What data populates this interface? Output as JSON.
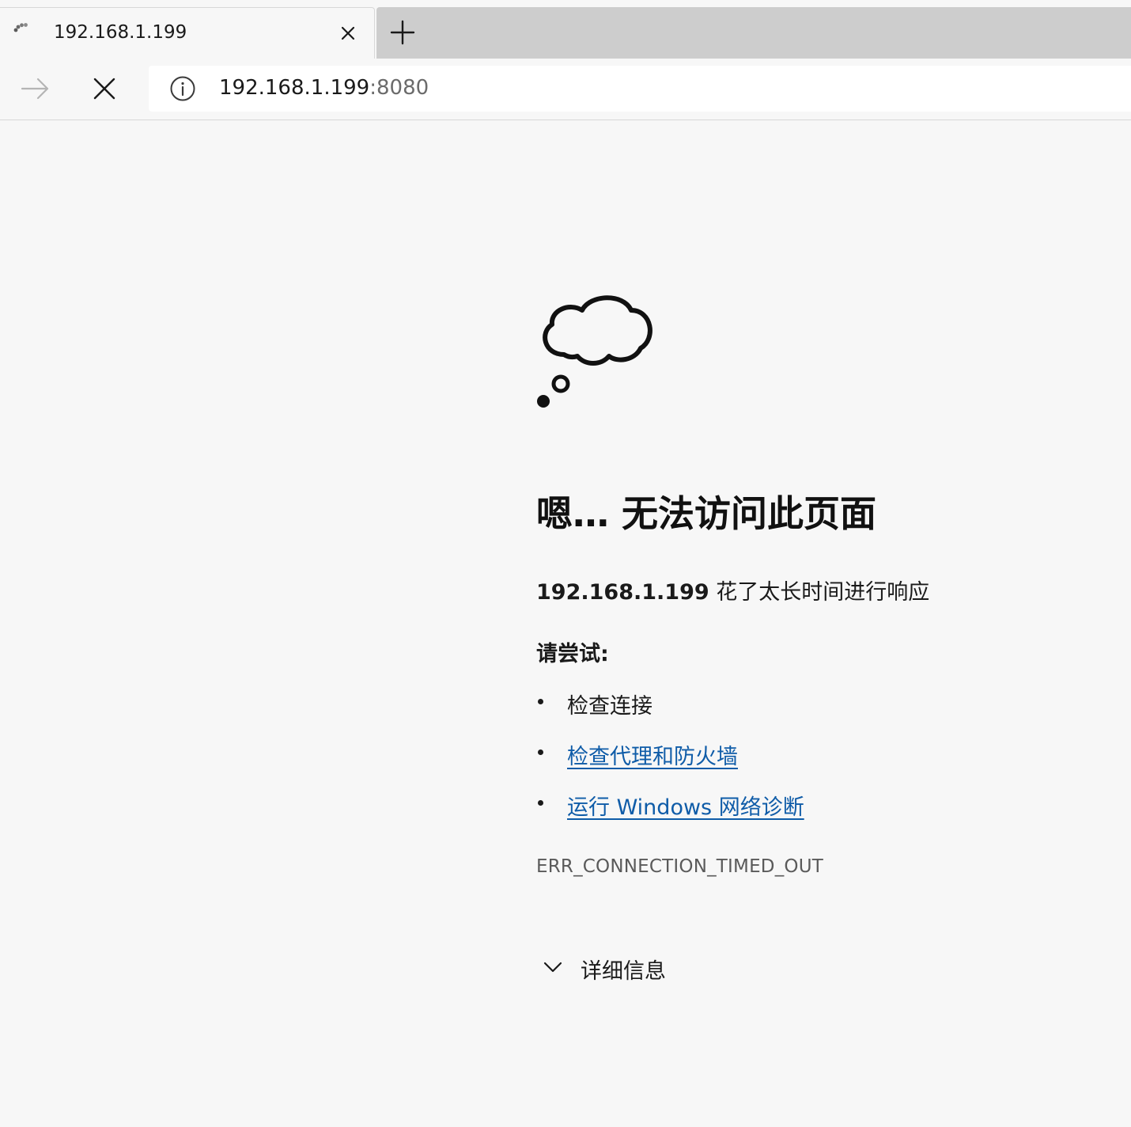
{
  "tab": {
    "title": "192.168.1.199",
    "favicon": "loading-spinner-icon",
    "close_icon": "close-icon"
  },
  "new_tab_icon": "plus-icon",
  "toolbar": {
    "forward_icon": "arrow-right-icon",
    "stop_icon": "close-icon",
    "info_icon": "info-icon",
    "url_host": "192.168.1.199",
    "url_port": ":8080"
  },
  "error_page": {
    "illustration": "thought-cloud-icon",
    "heading": "嗯… 无法访问此页面",
    "subtitle_host": "192.168.1.199",
    "subtitle_rest": " 花了太长时间进行响应",
    "try_label": "请尝试:",
    "suggestions": [
      {
        "text": "检查连接",
        "is_link": false
      },
      {
        "text": "检查代理和防火墙",
        "is_link": true
      },
      {
        "text": "运行 Windows 网络诊断",
        "is_link": true
      }
    ],
    "error_code": "ERR_CONNECTION_TIMED_OUT",
    "details_label": "详细信息",
    "details_icon": "chevron-down-icon"
  },
  "colors": {
    "page_background": "#f7f7f7",
    "tabstrip_background": "#cdcdcd",
    "link": "#0f5ca8",
    "error_code": "#5a5a5a"
  }
}
